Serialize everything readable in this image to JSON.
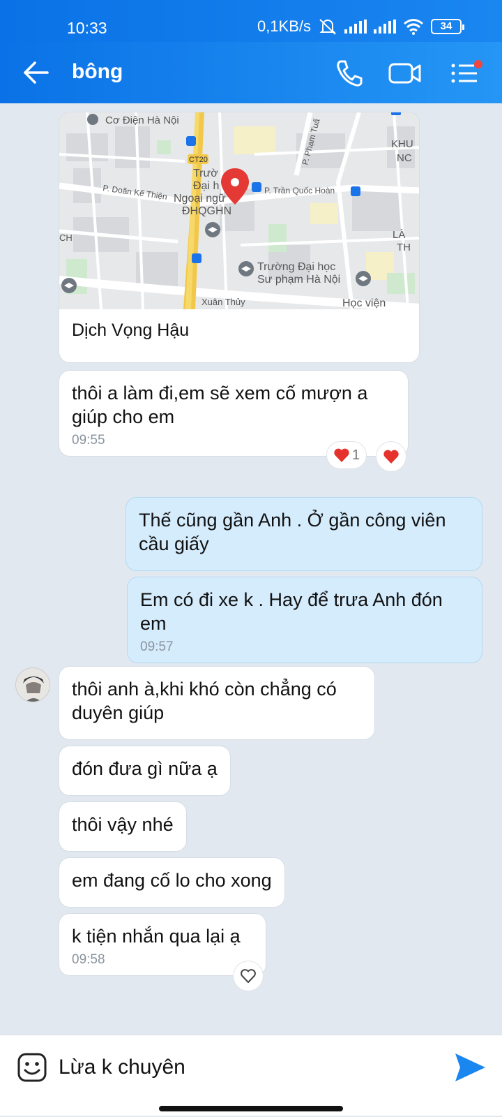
{
  "status": {
    "time": "10:33",
    "speed": "0,1KB/s",
    "battery": "34"
  },
  "header": {
    "title": "bông",
    "icons": [
      "back-arrow-icon",
      "phone-icon",
      "video-camera-icon",
      "menu-list-icon"
    ],
    "accent": "#1a86f0"
  },
  "map": {
    "labels": {
      "co_dien": "Cơ Điện Hà Nội",
      "ct20": "CT20",
      "truong1": "Trườ",
      "truong2": "Đại h",
      "truong3": "Ngoại ngữ",
      "truong4": "ĐHQGHN",
      "pham_tuan": "P. Phạm Tuấ",
      "tran_quoc_hoan": "P. Trần Quốc Hoàn",
      "doan_ke_thien": "P. Doãn Kế Thiện",
      "khu": "KHU",
      "nc": "NC",
      "ch": "CH",
      "lan": "LÀ",
      "th": "TH",
      "dhsp1": "Trường Đại học",
      "dhsp2": "Sư phạm Hà Nội",
      "xuan_thuy": "Xuân Thủy",
      "hoc_vien": "Học viện"
    },
    "caption": "Dịch Vọng Hậu"
  },
  "messages": [
    {
      "text": "thôi a làm đi,em sẽ xem cố mượn a giúp cho em",
      "time": "09:55"
    },
    {
      "text": "Thế cũng gần Anh . Ở gần công viên cầu giấy"
    },
    {
      "text": "Em có đi xe k . Hay để trưa Anh đón em",
      "time": "09:57"
    },
    {
      "text": "thôi anh à,khi khó còn chẳng có duyên giúp"
    },
    {
      "text": "đón đưa gì nữa ạ"
    },
    {
      "text": "thôi vậy nhé"
    },
    {
      "text": "em đang cố lo cho xong"
    },
    {
      "text": "k tiện nhắn qua lại ạ",
      "time": "09:58"
    }
  ],
  "reactions": {
    "heart_count": "1"
  },
  "input": {
    "value": "Lừa k chuyên"
  }
}
